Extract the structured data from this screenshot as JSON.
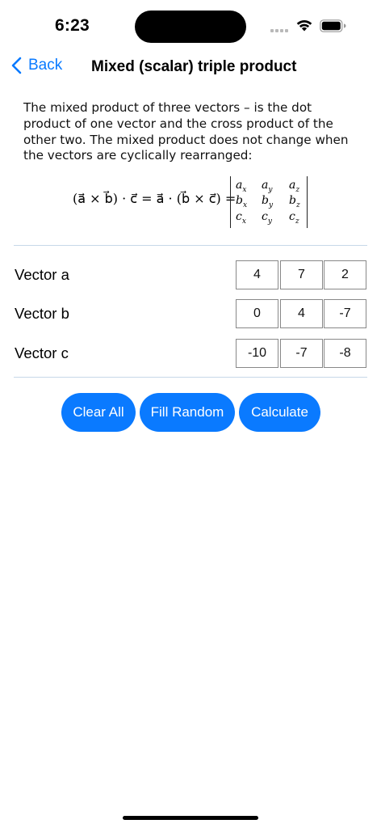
{
  "status_bar": {
    "time": "6:23"
  },
  "nav": {
    "back_label": "Back",
    "title": "Mixed (scalar) triple product"
  },
  "description": "The mixed product of three vectors – is the dot product of one vector and the cross product of the other two. The mixed product does not change when the vectors are cyclically rearranged:",
  "formula": {
    "lhs": "(a⃗ × b⃗) · c⃗ = a⃗ · (b⃗ × c⃗) =",
    "matrix": [
      {
        "base": "a",
        "subs": [
          "x",
          "y",
          "z"
        ]
      },
      {
        "base": "b",
        "subs": [
          "x",
          "y",
          "z"
        ]
      },
      {
        "base": "c",
        "subs": [
          "x",
          "y",
          "z"
        ]
      }
    ]
  },
  "vectors": [
    {
      "label": "Vector a",
      "values": [
        "4",
        "7",
        "2"
      ]
    },
    {
      "label": "Vector b",
      "values": [
        "0",
        "4",
        "-7"
      ]
    },
    {
      "label": "Vector c",
      "values": [
        "-10",
        "-7",
        "-8"
      ]
    }
  ],
  "buttons": {
    "clear": "Clear All",
    "random": "Fill Random",
    "calculate": "Calculate"
  },
  "colors": {
    "accent": "#0a7aff",
    "divider": "#c7d8e8"
  }
}
